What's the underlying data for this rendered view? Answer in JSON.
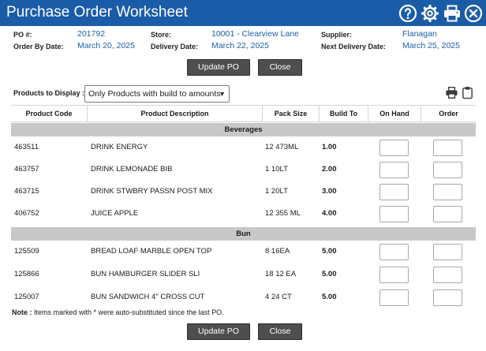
{
  "window": {
    "title": "Purchase Order Worksheet",
    "icons": [
      "help-icon",
      "gear-icon",
      "print-icon",
      "close-icon"
    ]
  },
  "header": {
    "po_label": "PO #:",
    "po_value": "201792",
    "order_by_label": "Order By Date:",
    "order_by_value": "March 20, 2025",
    "store_label": "Store:",
    "store_value": "10001 - Clearview Lane",
    "delivery_label": "Delivery Date:",
    "delivery_value": "March 22, 2025",
    "supplier_label": "Supplier:",
    "supplier_value": "Flanagan",
    "next_delivery_label": "Next Delivery Date:",
    "next_delivery_value": "March 25, 2025"
  },
  "buttons": {
    "update": "Update PO",
    "close": "Close"
  },
  "filter": {
    "label": "Products to Display :",
    "selected": "Only Products with build to amounts"
  },
  "table": {
    "columns": [
      "Product Code",
      "Product Description",
      "Pack Size",
      "Build To",
      "On Hand",
      "Order"
    ],
    "groups": [
      {
        "name": "Beverages",
        "rows": [
          {
            "code": "463511",
            "description": "DRINK ENERGY",
            "pack": "12 473ML",
            "build_to": "1.00"
          },
          {
            "code": "463757",
            "description": "DRINK LEMONADE BIB",
            "pack": "1 10LT",
            "build_to": "2.00"
          },
          {
            "code": "463715",
            "description": "DRINK STWBRY PASSN POST MIX",
            "pack": "1 20LT",
            "build_to": "3.00"
          },
          {
            "code": "406752",
            "description": "JUICE APPLE",
            "pack": "12 355 ML",
            "build_to": "4.00"
          }
        ]
      },
      {
        "name": "Bun",
        "rows": [
          {
            "code": "125509",
            "description": "BREAD LOAF MARBLE OPEN TOP",
            "pack": "8 16EA",
            "build_to": "5.00"
          },
          {
            "code": "125866",
            "description": "BUN HAMBURGER SLIDER SLI",
            "pack": "18 12 EA",
            "build_to": "5.00"
          },
          {
            "code": "125007",
            "description": "BUN SANDWICH 4\" CROSS CUT",
            "pack": "4 24 CT",
            "build_to": "5.00"
          }
        ]
      }
    ]
  },
  "note": {
    "label": "Note :",
    "text": "Items marked with * were auto-substituted since the last PO."
  }
}
